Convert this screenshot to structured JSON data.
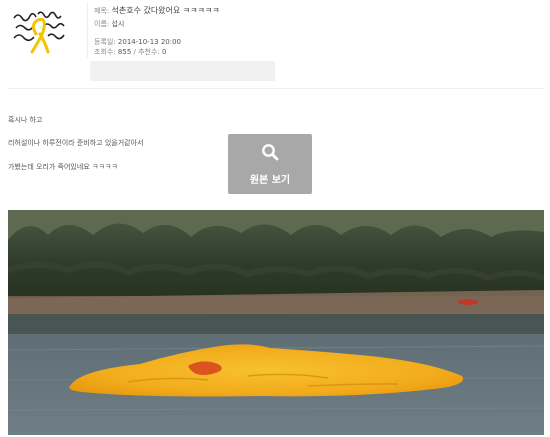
{
  "post": {
    "title_label": "제목",
    "title_value": "석촌호수 갔다왔어요 ㅋㅋㅋㅋㅋ",
    "name_label": "이름",
    "name_value": "섭시",
    "date_label": "등록일",
    "date_value": "2014-10-13 20:00",
    "views_label": "조회수",
    "views_value": "855",
    "recommend_label": "추천수",
    "recommend_value": "0"
  },
  "body": {
    "line1": "혹시나 하고",
    "line2": "리허설이나 하루전이라 준비하고 있을거같아서",
    "line3": "가봤는데 오리가 죽어있네요 ㅋㅋㅋㅋ"
  },
  "view_original_button": {
    "label": "원본 보기",
    "icon": "magnifier-icon"
  },
  "colors": {
    "button_bg": "#a8a8a8",
    "ribbon": "#f2c500",
    "duck_yellow": "#f4b11c"
  }
}
